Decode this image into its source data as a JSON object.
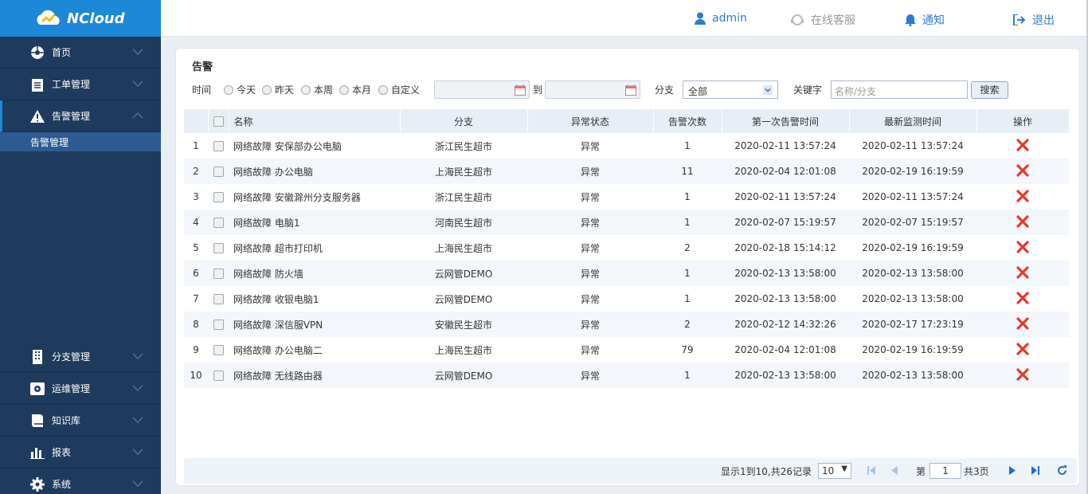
{
  "app": {
    "name": "NCloud"
  },
  "sidebar": {
    "items": [
      {
        "label": "首页",
        "icon": "dashboard-icon"
      },
      {
        "label": "工单管理",
        "icon": "clipboard-icon"
      },
      {
        "label": "告警管理",
        "icon": "warning-icon"
      },
      {
        "label": "分支管理",
        "icon": "building-icon"
      },
      {
        "label": "运维管理",
        "icon": "settings-box-icon"
      },
      {
        "label": "知识库",
        "icon": "book-icon"
      },
      {
        "label": "报表",
        "icon": "bar-chart-icon"
      },
      {
        "label": "系统",
        "icon": "gear-icon"
      }
    ],
    "submenu": {
      "label": "告警管理"
    }
  },
  "topbar": {
    "user": "admin",
    "support": "在线客服",
    "notify": "通知",
    "logout": "退出"
  },
  "panel": {
    "title": "告警"
  },
  "filters": {
    "time_label": "时间",
    "radios": [
      "今天",
      "昨天",
      "本周",
      "本月",
      "自定义"
    ],
    "to_label": "到",
    "branch_label": "分支",
    "branch_value": "全部",
    "keyword_label": "关键字",
    "keyword_placeholder": "名称/分支",
    "search_button": "搜索"
  },
  "table": {
    "headers": {
      "name": "名称",
      "branch": "分支",
      "status": "异常状态",
      "count": "告警次数",
      "first": "第一次告警时间",
      "latest": "最新监测时间",
      "action": "操作"
    },
    "rows": [
      {
        "no": "1",
        "name": "网络故障 安保部办公电脑",
        "branch": "浙江民生超市",
        "status": "异常",
        "count": "1",
        "first": "2020-02-11 13:57:24",
        "latest": "2020-02-11 13:57:24"
      },
      {
        "no": "2",
        "name": "网络故障 办公电脑",
        "branch": "上海民生超市",
        "status": "异常",
        "count": "11",
        "first": "2020-02-04 12:01:08",
        "latest": "2020-02-19 16:19:59"
      },
      {
        "no": "3",
        "name": "网络故障 安徽滁州分支服务器",
        "branch": "浙江民生超市",
        "status": "异常",
        "count": "1",
        "first": "2020-02-11 13:57:24",
        "latest": "2020-02-11 13:57:24"
      },
      {
        "no": "4",
        "name": "网络故障 电脑1",
        "branch": "河南民生超市",
        "status": "异常",
        "count": "1",
        "first": "2020-02-07 15:19:57",
        "latest": "2020-02-07 15:19:57"
      },
      {
        "no": "5",
        "name": "网络故障 超市打印机",
        "branch": "上海民生超市",
        "status": "异常",
        "count": "2",
        "first": "2020-02-18 15:14:12",
        "latest": "2020-02-19 16:19:59"
      },
      {
        "no": "6",
        "name": "网络故障 防火墙",
        "branch": "云网管DEMO",
        "status": "异常",
        "count": "1",
        "first": "2020-02-13 13:58:00",
        "latest": "2020-02-13 13:58:00"
      },
      {
        "no": "7",
        "name": "网络故障 收银电脑1",
        "branch": "云网管DEMO",
        "status": "异常",
        "count": "1",
        "first": "2020-02-13 13:58:00",
        "latest": "2020-02-13 13:58:00"
      },
      {
        "no": "8",
        "name": "网络故障 深信服VPN",
        "branch": "安徽民生超市",
        "status": "异常",
        "count": "2",
        "first": "2020-02-12 14:32:26",
        "latest": "2020-02-17 17:23:19"
      },
      {
        "no": "9",
        "name": "网络故障 办公电脑二",
        "branch": "上海民生超市",
        "status": "异常",
        "count": "79",
        "first": "2020-02-04 12:01:08",
        "latest": "2020-02-19 16:19:59"
      },
      {
        "no": "10",
        "name": "网络故障 无线路由器",
        "branch": "云网管DEMO",
        "status": "异常",
        "count": "1",
        "first": "2020-02-13 13:58:00",
        "latest": "2020-02-13 13:58:00"
      }
    ]
  },
  "pager": {
    "summary": "显示1到10,共26记录",
    "page_size": "10",
    "page_label": "第",
    "page_value": "1",
    "total_label": "共3页"
  },
  "colors": {
    "brand": "#1d87d8",
    "sidebar": "#1e3a5c",
    "delete": "#e8382e"
  }
}
